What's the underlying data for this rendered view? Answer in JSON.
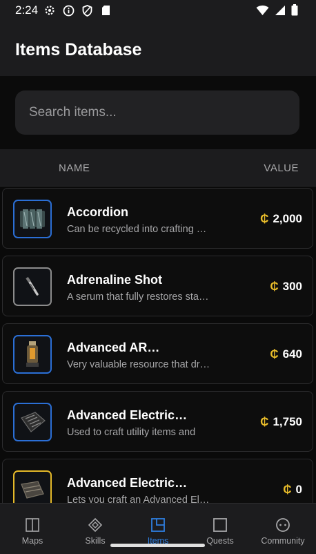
{
  "status_bar": {
    "time": "2:24",
    "icons": [
      "gear-icon",
      "info-icon",
      "shield-icon",
      "sd-card-icon"
    ],
    "right_icons": [
      "wifi-icon",
      "signal-icon",
      "battery-icon"
    ]
  },
  "header": {
    "title": "Items Database"
  },
  "search": {
    "placeholder": "Search items...",
    "value": ""
  },
  "table_header": {
    "name": "NAME",
    "value": "VALUE"
  },
  "currency_symbol": "₵",
  "items": [
    {
      "name": "Accordion",
      "description": "Can be recycled into crafting materials",
      "value": "2,000",
      "rarity_color": "#2b6fd6"
    },
    {
      "name": "Adrenaline Shot",
      "description": "A serum that fully restores stamina",
      "value": "300",
      "rarity_color": "#8c8c8c"
    },
    {
      "name": "Advanced AR…",
      "description": "Very valuable resource that drops",
      "value": "640",
      "rarity_color": "#2b6fd6"
    },
    {
      "name": "Advanced Electric…",
      "description": "Used to craft utility items and",
      "value": "1,750",
      "rarity_color": "#2b6fd6"
    },
    {
      "name": "Advanced Electric…",
      "description": "Lets you craft an Advanced Electrical",
      "value": "0",
      "rarity_color": "#e5b929"
    }
  ],
  "bottom_nav": [
    {
      "label": "Maps",
      "icon": "map-icon",
      "active": false
    },
    {
      "label": "Skills",
      "icon": "diamond-icon",
      "active": false
    },
    {
      "label": "Items",
      "icon": "items-icon",
      "active": true
    },
    {
      "label": "Quests",
      "icon": "quests-icon",
      "active": false
    },
    {
      "label": "Community",
      "icon": "community-icon",
      "active": false
    }
  ],
  "colors": {
    "accent": "#2f7fe0",
    "coin": "#e9bd2a",
    "background": "#0c0c0c",
    "surface": "#1c1c1e"
  }
}
